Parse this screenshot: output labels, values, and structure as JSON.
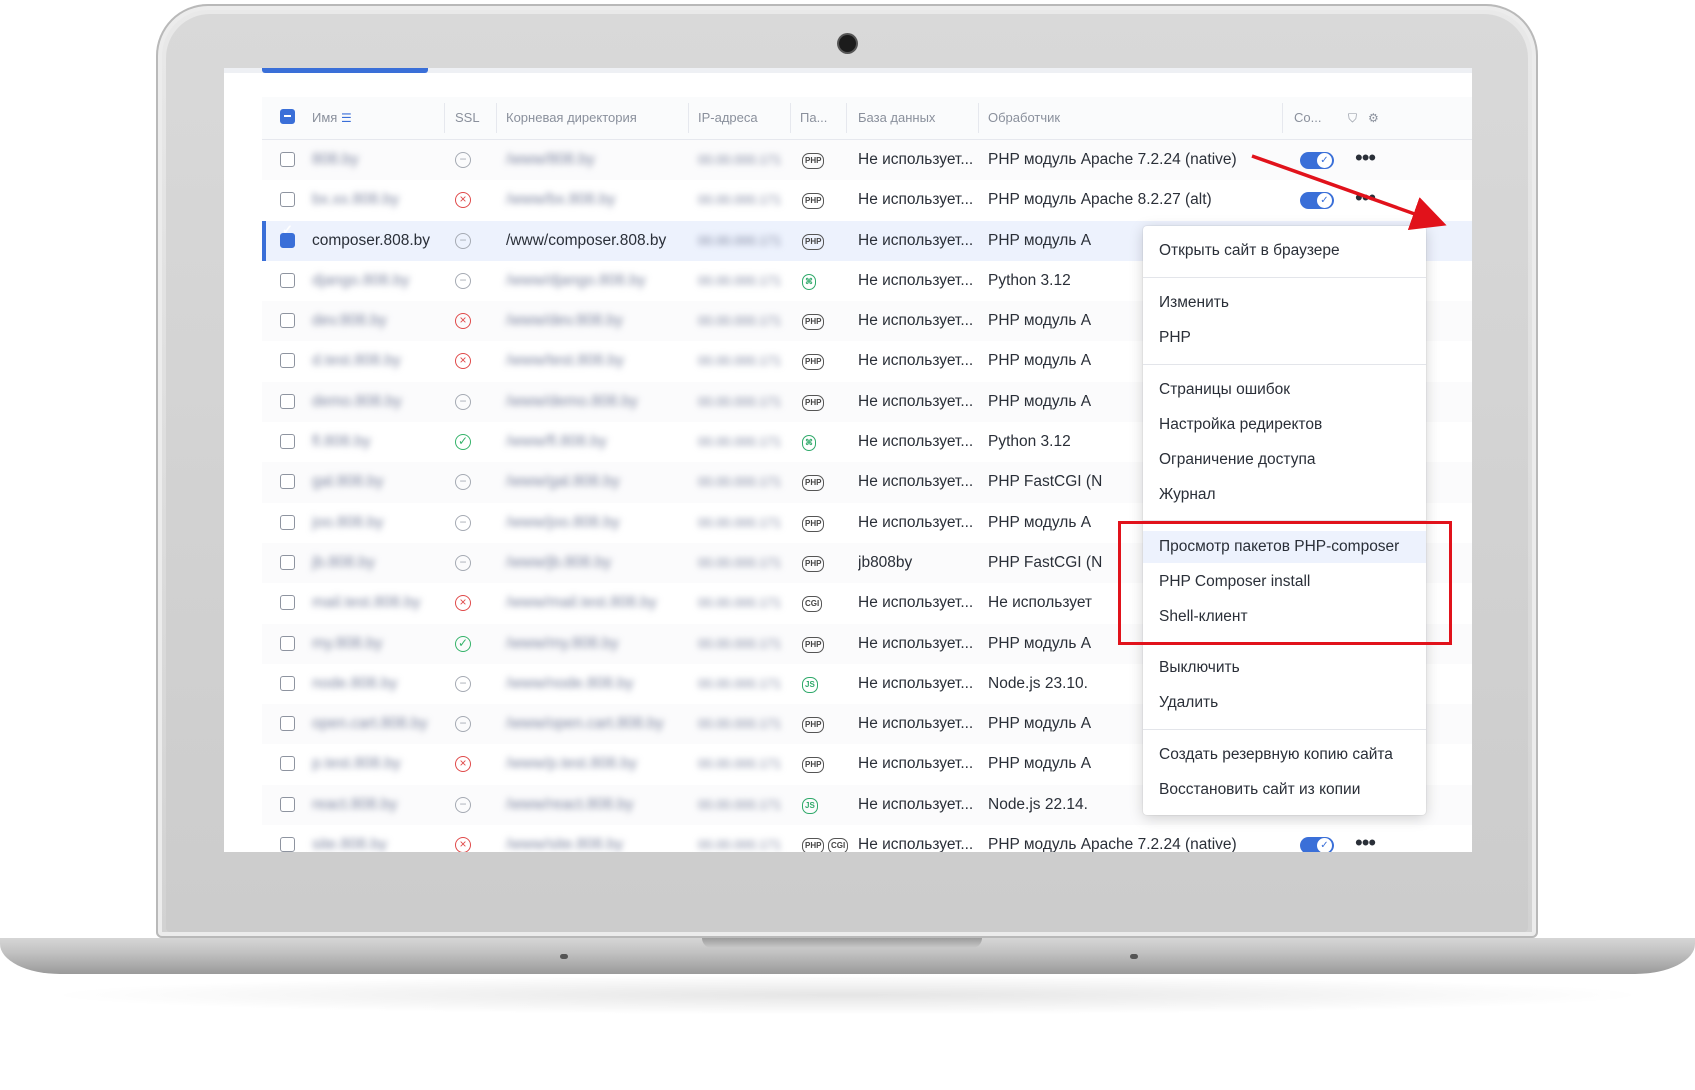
{
  "columns": {
    "name": "Имя",
    "ssl": "SSL",
    "root": "Корневая директория",
    "ip": "IP-адреса",
    "pa": "Па...",
    "db": "База данных",
    "handler": "Обработчик",
    "status": "Со..."
  },
  "rows": [
    {
      "name": "808.by",
      "ssl": "none",
      "root": "/www/808.by",
      "ip": "00.00.000.171",
      "pkg": "PHP",
      "db": "Не использует...",
      "handler": "PHP модуль Apache 7.2.24 (native)",
      "toggle": true
    },
    {
      "name": "bx.xx.808.by",
      "ssl": "bad",
      "root": "/www/bx.808.by",
      "ip": "00.00.000.171",
      "pkg": "PHP",
      "db": "Не использует...",
      "handler": "PHP модуль Apache 8.2.27 (alt)",
      "toggle": true
    },
    {
      "name": "composer.808.by",
      "ssl": "none",
      "root": "/www/composer.808.by",
      "ip": "00.00.000.171",
      "pkg": "PHP",
      "db": "Не использует...",
      "handler": "PHP модуль A",
      "toggle": false,
      "selected": true
    },
    {
      "name": "django.808.by",
      "ssl": "none",
      "root": "/www/django.808.by",
      "ip": "00.00.000.171",
      "pkg": "PY",
      "db": "Не использует...",
      "handler": "Python 3.12",
      "toggle": false
    },
    {
      "name": "dev.808.by",
      "ssl": "bad",
      "root": "/www/dev.808.by",
      "ip": "00.00.000.171",
      "pkg": "PHP",
      "db": "Не использует...",
      "handler": "PHP модуль A",
      "toggle": false
    },
    {
      "name": "d.test.808.by",
      "ssl": "bad",
      "root": "/www/test.808.by",
      "ip": "00.00.000.171",
      "pkg": "PHP",
      "db": "Не использует...",
      "handler": "PHP модуль A",
      "toggle": false
    },
    {
      "name": "demo.808.by",
      "ssl": "none",
      "root": "/www/demo.808.by",
      "ip": "00.00.000.171",
      "pkg": "PHP",
      "db": "Не использует...",
      "handler": "PHP модуль A",
      "toggle": false
    },
    {
      "name": "fl.808.by",
      "ssl": "ok",
      "root": "/www/fl.808.by",
      "ip": "00.00.000.171",
      "pkg": "PY",
      "db": "Не использует...",
      "handler": "Python 3.12",
      "toggle": false
    },
    {
      "name": "gal.808.by",
      "ssl": "none",
      "root": "/www/gal.808.by",
      "ip": "00.00.000.171",
      "pkg": "PHP",
      "db": "Не использует...",
      "handler": "PHP FastCGI (N",
      "toggle": false
    },
    {
      "name": "joo.808.by",
      "ssl": "none",
      "root": "/www/joo.808.by",
      "ip": "00.00.000.171",
      "pkg": "PHP",
      "db": "Не использует...",
      "handler": "PHP модуль A",
      "toggle": false
    },
    {
      "name": "jb.808.by",
      "ssl": "none",
      "root": "/www/jb.808.by",
      "ip": "00.00.000.171",
      "pkg": "PHP",
      "db": "jb808by",
      "handler": "PHP FastCGI (N",
      "toggle": false
    },
    {
      "name": "mail.test.808.by",
      "ssl": "bad",
      "root": "/www/mail.test.808.by",
      "ip": "00.00.000.171",
      "pkg": "CGI",
      "db": "Не использует...",
      "handler": "Не использует",
      "toggle": false
    },
    {
      "name": "my.808.by",
      "ssl": "ok",
      "root": "/www/my.808.by",
      "ip": "00.00.000.171",
      "pkg": "PHP",
      "db": "Не использует...",
      "handler": "PHP модуль A",
      "toggle": false
    },
    {
      "name": "node.808.by",
      "ssl": "none",
      "root": "/www/node.808.by",
      "ip": "00.00.000.171",
      "pkg": "JS",
      "db": "Не использует...",
      "handler": "Node.js 23.10.",
      "toggle": false
    },
    {
      "name": "open.cart.808.by",
      "ssl": "none",
      "root": "/www/open.cart.808.by",
      "ip": "00.00.000.171",
      "pkg": "PHP",
      "db": "Не использует...",
      "handler": "PHP модуль A",
      "toggle": false
    },
    {
      "name": "p.test.808.by",
      "ssl": "bad",
      "root": "/www/p.test.808.by",
      "ip": "00.00.000.171",
      "pkg": "PHP",
      "db": "Не использует...",
      "handler": "PHP модуль A",
      "toggle": false
    },
    {
      "name": "react.808.by",
      "ssl": "none",
      "root": "/www/react.808.by",
      "ip": "00.00.000.171",
      "pkg": "JS",
      "db": "Не использует...",
      "handler": "Node.js 22.14.",
      "toggle": false
    },
    {
      "name": "site.808.by",
      "ssl": "bad",
      "root": "/www/site.808.by",
      "ip": "00.00.000.171",
      "pkg": "PHP CGI",
      "db": "Не использует...",
      "handler": "PHP модуль Apache 7.2.24 (native)",
      "toggle": true
    }
  ],
  "menu": {
    "open_browser": "Открыть сайт в браузере",
    "edit": "Изменить",
    "php": "PHP",
    "error_pages": "Страницы ошибок",
    "redirects": "Настройка редиректов",
    "access": "Ограничение доступа",
    "log": "Журнал",
    "composer_view": "Просмотр пакетов PHP-composer",
    "composer_install": "PHP Composer install",
    "shell": "Shell-клиент",
    "disable": "Выключить",
    "delete": "Удалить",
    "backup": "Создать резервную копию сайта",
    "restore": "Восстановить сайт из копии"
  },
  "colors": {
    "accent": "#3a6fd8",
    "annotation": "#e1121b",
    "ssl_ok": "#35b36a",
    "ssl_bad": "#e04a4a"
  }
}
